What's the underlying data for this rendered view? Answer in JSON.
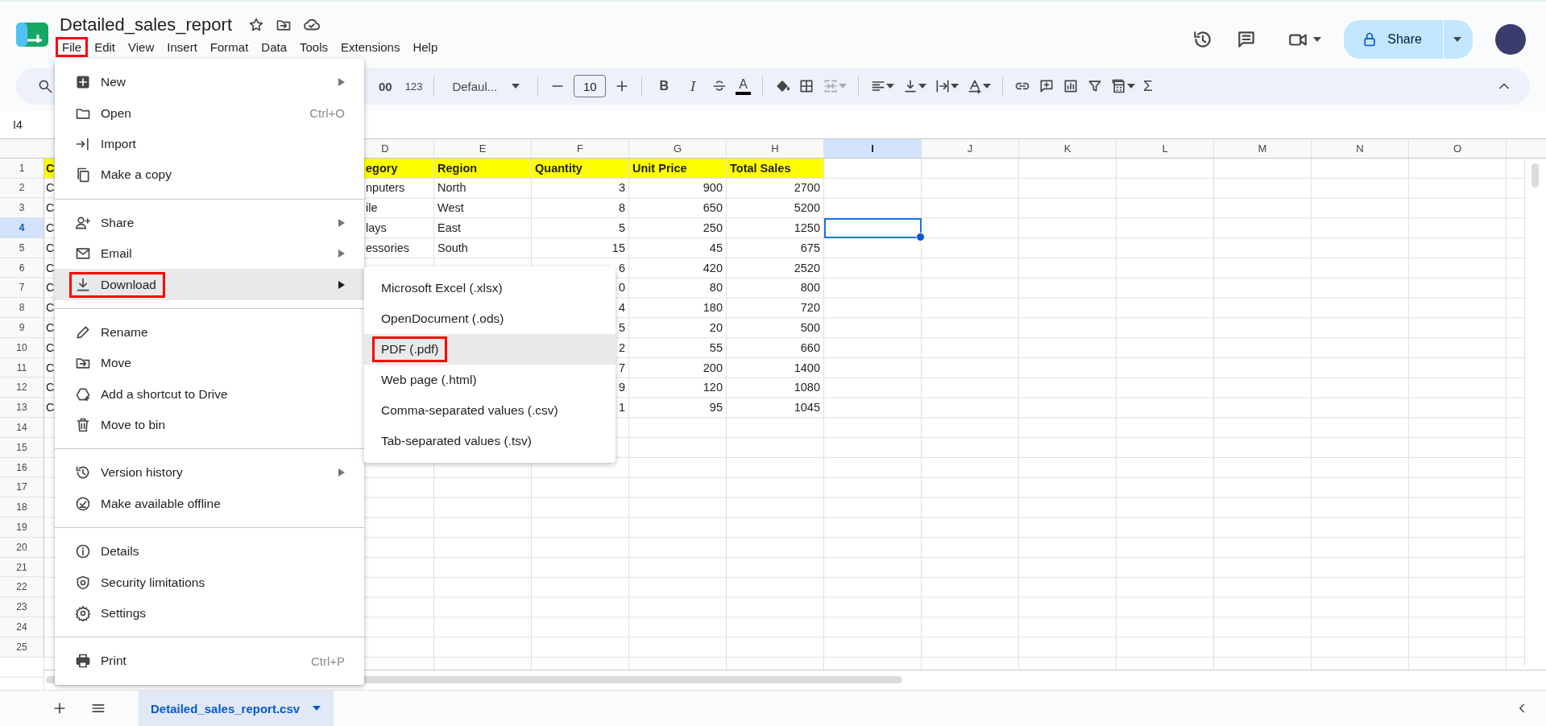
{
  "app": {
    "title": "Detailed_sales_report"
  },
  "menubar": [
    {
      "label": "File",
      "annotated": true
    },
    {
      "label": "Edit",
      "annotated": false
    },
    {
      "label": "View",
      "annotated": false
    },
    {
      "label": "Insert",
      "annotated": false
    },
    {
      "label": "Format",
      "annotated": false
    },
    {
      "label": "Data",
      "annotated": false
    },
    {
      "label": "Tools",
      "annotated": false
    },
    {
      "label": "Extensions",
      "annotated": false
    },
    {
      "label": "Help",
      "annotated": false
    }
  ],
  "share_button": {
    "label": "Share"
  },
  "toolbar": {
    "decimal_label": "00",
    "format_label": "123",
    "font": "Defaul...",
    "font_size": "10",
    "bold_label": "B",
    "italic_label": "I",
    "text_color_label": "A",
    "sum_label": "Σ",
    "merge_disabled": true
  },
  "name_box": "I4",
  "columns": [
    {
      "label": "D",
      "selected": false
    },
    {
      "label": "E",
      "selected": false
    },
    {
      "label": "F",
      "selected": false
    },
    {
      "label": "G",
      "selected": false
    },
    {
      "label": "H",
      "selected": false
    },
    {
      "label": "I",
      "selected": true
    },
    {
      "label": "J",
      "selected": false
    },
    {
      "label": "K",
      "selected": false
    },
    {
      "label": "L",
      "selected": false
    },
    {
      "label": "M",
      "selected": false
    },
    {
      "label": "N",
      "selected": false
    },
    {
      "label": "O",
      "selected": false
    }
  ],
  "rows": [
    {
      "label": "1",
      "selected": false,
      "kind": "header",
      "a": "C",
      "d": "egory",
      "e": "Region",
      "f": "Quantity",
      "g": "Unit Price",
      "h": "Total Sales"
    },
    {
      "label": "2",
      "selected": false,
      "kind": "data",
      "a": "C",
      "d": "nputers",
      "e": "North",
      "f": "3",
      "g": "900",
      "h": "2700"
    },
    {
      "label": "3",
      "selected": false,
      "kind": "data",
      "a": "C",
      "d": "ile",
      "e": "West",
      "f": "8",
      "g": "650",
      "h": "5200"
    },
    {
      "label": "4",
      "selected": true,
      "kind": "data",
      "a": "C",
      "d": "lays",
      "e": "East",
      "f": "5",
      "g": "250",
      "h": "1250"
    },
    {
      "label": "5",
      "selected": false,
      "kind": "data",
      "a": "C",
      "d": "essories",
      "e": "South",
      "f": "15",
      "g": "45",
      "h": "675"
    },
    {
      "label": "6",
      "selected": false,
      "kind": "data",
      "a": "C",
      "f": "6",
      "g": "420",
      "h": "2520"
    },
    {
      "label": "7",
      "selected": false,
      "kind": "data",
      "a": "C",
      "f": "0",
      "g": "80",
      "h": "800"
    },
    {
      "label": "8",
      "selected": false,
      "kind": "data",
      "a": "C",
      "f": "4",
      "g": "180",
      "h": "720"
    },
    {
      "label": "9",
      "selected": false,
      "kind": "data",
      "a": "C",
      "f": "5",
      "g": "20",
      "h": "500"
    },
    {
      "label": "10",
      "selected": false,
      "kind": "data",
      "a": "C",
      "f": "2",
      "g": "55",
      "h": "660"
    },
    {
      "label": "11",
      "selected": false,
      "kind": "data",
      "a": "C",
      "f": "7",
      "g": "200",
      "h": "1400"
    },
    {
      "label": "12",
      "selected": false,
      "kind": "data",
      "a": "C",
      "f": "9",
      "g": "120",
      "h": "1080"
    },
    {
      "label": "13",
      "selected": false,
      "kind": "data",
      "a": "C",
      "f": "1",
      "g": "95",
      "h": "1045"
    },
    {
      "label": "14",
      "selected": false,
      "kind": "empty"
    },
    {
      "label": "15",
      "selected": false,
      "kind": "empty"
    },
    {
      "label": "16",
      "selected": false,
      "kind": "empty"
    },
    {
      "label": "17",
      "selected": false,
      "kind": "empty"
    },
    {
      "label": "18",
      "selected": false,
      "kind": "empty"
    },
    {
      "label": "19",
      "selected": false,
      "kind": "empty"
    },
    {
      "label": "20",
      "selected": false,
      "kind": "empty"
    },
    {
      "label": "21",
      "selected": false,
      "kind": "empty"
    },
    {
      "label": "22",
      "selected": false,
      "kind": "empty"
    },
    {
      "label": "23",
      "selected": false,
      "kind": "empty"
    },
    {
      "label": "24",
      "selected": false,
      "kind": "empty"
    },
    {
      "label": "25",
      "selected": false,
      "kind": "empty"
    }
  ],
  "file_menu": {
    "sections": [
      [
        {
          "label": "New",
          "submenu": true,
          "selected": false,
          "annotated": false
        },
        {
          "label": "Open",
          "shortcut": "Ctrl+O",
          "submenu": false,
          "selected": false,
          "annotated": false
        },
        {
          "label": "Import",
          "submenu": false,
          "selected": false,
          "annotated": false
        },
        {
          "label": "Make a copy",
          "submenu": false,
          "selected": false,
          "annotated": false
        }
      ],
      [
        {
          "label": "Share",
          "submenu": true,
          "selected": false,
          "annotated": false
        },
        {
          "label": "Email",
          "submenu": true,
          "selected": false,
          "annotated": false
        },
        {
          "label": "Download",
          "submenu": true,
          "selected": true,
          "annotated": true
        }
      ],
      [
        {
          "label": "Rename",
          "submenu": false,
          "selected": false,
          "annotated": false
        },
        {
          "label": "Move",
          "submenu": false,
          "selected": false,
          "annotated": false
        },
        {
          "label": "Add a shortcut to Drive",
          "submenu": false,
          "selected": false,
          "annotated": false
        },
        {
          "label": "Move to bin",
          "submenu": false,
          "selected": false,
          "annotated": false
        }
      ],
      [
        {
          "label": "Version history",
          "submenu": true,
          "selected": false,
          "annotated": false
        },
        {
          "label": "Make available offline",
          "submenu": false,
          "selected": false,
          "annotated": false
        }
      ],
      [
        {
          "label": "Details",
          "submenu": false,
          "selected": false,
          "annotated": false
        },
        {
          "label": "Security limitations",
          "submenu": false,
          "selected": false,
          "annotated": false
        },
        {
          "label": "Settings",
          "submenu": false,
          "selected": false,
          "annotated": false
        }
      ],
      [
        {
          "label": "Print",
          "shortcut": "Ctrl+P",
          "submenu": false,
          "selected": false,
          "annotated": false
        }
      ]
    ]
  },
  "download_submenu": [
    {
      "label": "Microsoft Excel (.xlsx)",
      "selected": false,
      "annotated": false
    },
    {
      "label": "OpenDocument (.ods)",
      "selected": false,
      "annotated": false
    },
    {
      "label": "PDF (.pdf)",
      "selected": true,
      "annotated": true
    },
    {
      "label": "Web page (.html)",
      "selected": false,
      "annotated": false
    },
    {
      "label": "Comma-separated values (.csv)",
      "selected": false,
      "annotated": false
    },
    {
      "label": "Tab-separated values (.tsv)",
      "selected": false,
      "annotated": false
    }
  ],
  "sheet_tabs": [
    {
      "label": "Detailed_sales_report.csv",
      "selected": true
    }
  ]
}
